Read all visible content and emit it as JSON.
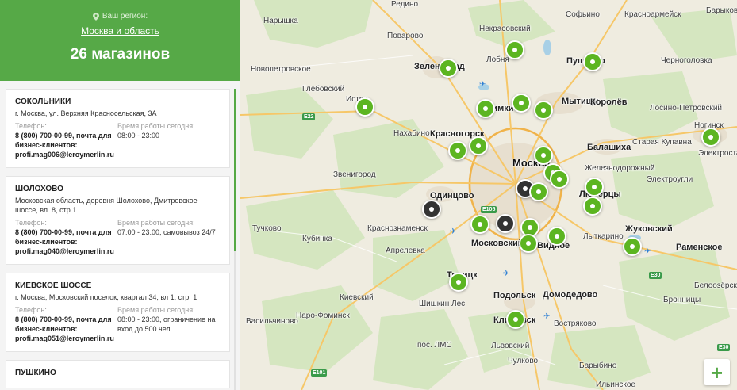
{
  "panel": {
    "region_label": "Ваш регион:",
    "region_name": "Москва и область",
    "store_count": "26 магазинов"
  },
  "stores": [
    {
      "name": "СОКОЛЬНИКИ",
      "address": "г. Москва, ул. Верхняя Красносельская, 3А",
      "phone_label": "Телефон:",
      "phone": "8 (800) 700-00-99, почта для бизнес-клиентов: profi.mag006@leroymerlin.ru",
      "hours_label": "Время работы сегодня:",
      "hours": "08:00 - 23:00"
    },
    {
      "name": "ШОЛОХОВО",
      "address": "Московская область, деревня Шолохово, Дмитровское шоссе, вл. 8, стр.1",
      "phone_label": "Телефон:",
      "phone": "8 (800) 700-00-99, почта для бизнес-клиентов: profi.mag040@leroymerlin.ru",
      "hours_label": "Время работы сегодня:",
      "hours": "07:00 - 23:00, самовывоз 24/7"
    },
    {
      "name": "КИЕВСКОЕ ШОССЕ",
      "address": "г. Москва, Московский поселок, квартал 34, вл 1, стр. 1",
      "phone_label": "Телефон:",
      "phone": "8 (800) 700-00-99, почта для бизнес-клиентов: profi.mag051@leroymerlin.ru",
      "hours_label": "Время работы сегодня:",
      "hours": "08:00 - 23:00, ограничение на вход до 500 чел."
    },
    {
      "name": "ПУШКИНО",
      "address": "",
      "phone_label": "",
      "phone": "",
      "hours_label": "",
      "hours": ""
    }
  ],
  "map": {
    "labels": [
      {
        "text": "Редино",
        "cls": ""
      },
      {
        "text": "Софьино",
        "cls": ""
      },
      {
        "text": "Красноармейск",
        "cls": ""
      },
      {
        "text": "Барыково",
        "cls": ""
      },
      {
        "text": "Нарышка",
        "cls": ""
      },
      {
        "text": "Некрасовский",
        "cls": ""
      },
      {
        "text": "Пушкино",
        "cls": "big"
      },
      {
        "text": "Черноголовка",
        "cls": ""
      },
      {
        "text": "Поварово",
        "cls": ""
      },
      {
        "text": "Зеленоград",
        "cls": "big"
      },
      {
        "text": "Лобня",
        "cls": ""
      },
      {
        "text": "Новопетровское",
        "cls": ""
      },
      {
        "text": "Глебовский",
        "cls": ""
      },
      {
        "text": "Истра",
        "cls": ""
      },
      {
        "text": "Мытищи",
        "cls": "big"
      },
      {
        "text": "Королёв",
        "cls": "big"
      },
      {
        "text": "Лосино-Петровский",
        "cls": ""
      },
      {
        "text": "Ногинск",
        "cls": ""
      },
      {
        "text": "Химки",
        "cls": "big"
      },
      {
        "text": "Нахабино",
        "cls": ""
      },
      {
        "text": "Красногорск",
        "cls": "big"
      },
      {
        "text": "Балашиха",
        "cls": "big"
      },
      {
        "text": "Старая Купавна",
        "cls": ""
      },
      {
        "text": "Электросталь",
        "cls": ""
      },
      {
        "text": "Звенигород",
        "cls": ""
      },
      {
        "text": "Москва",
        "cls": "capital"
      },
      {
        "text": "Железнодорожный",
        "cls": ""
      },
      {
        "text": "Электроугли",
        "cls": ""
      },
      {
        "text": "Одинцово",
        "cls": "big"
      },
      {
        "text": "Люберцы",
        "cls": "big"
      },
      {
        "text": "Тучково",
        "cls": ""
      },
      {
        "text": "Кубинка",
        "cls": ""
      },
      {
        "text": "Краснознаменск",
        "cls": ""
      },
      {
        "text": "Московский",
        "cls": "big"
      },
      {
        "text": "Жуковский",
        "cls": "big"
      },
      {
        "text": "Апрелевка",
        "cls": ""
      },
      {
        "text": "Видное",
        "cls": "big"
      },
      {
        "text": "Лыткарино",
        "cls": ""
      },
      {
        "text": "Раменское",
        "cls": "big"
      },
      {
        "text": "Троицк",
        "cls": "big"
      },
      {
        "text": "Белоозёрский",
        "cls": ""
      },
      {
        "text": "Киевский",
        "cls": ""
      },
      {
        "text": "Подольск",
        "cls": "big"
      },
      {
        "text": "Домодедово",
        "cls": "big"
      },
      {
        "text": "Бронницы",
        "cls": ""
      },
      {
        "text": "Шишкин Лес",
        "cls": ""
      },
      {
        "text": "Наро-Фоминск",
        "cls": ""
      },
      {
        "text": "Климовск",
        "cls": "big"
      },
      {
        "text": "Востряково",
        "cls": ""
      },
      {
        "text": "Васильчиново",
        "cls": ""
      },
      {
        "text": "пос. ЛМС",
        "cls": ""
      },
      {
        "text": "Львовский",
        "cls": ""
      },
      {
        "text": "Чулково",
        "cls": ""
      },
      {
        "text": "Барыбино",
        "cls": ""
      },
      {
        "text": "Ильинское",
        "cls": ""
      }
    ],
    "roads": [
      "E22",
      "E105",
      "E30",
      "E30",
      "E101"
    ],
    "stores_pins": [
      {
        "kind": "green"
      },
      {
        "kind": "green"
      },
      {
        "kind": "green"
      },
      {
        "kind": "green"
      },
      {
        "kind": "green"
      },
      {
        "kind": "green"
      },
      {
        "kind": "green"
      },
      {
        "kind": "green"
      },
      {
        "kind": "green"
      },
      {
        "kind": "green"
      },
      {
        "kind": "green"
      },
      {
        "kind": "green"
      },
      {
        "kind": "green"
      },
      {
        "kind": "green"
      },
      {
        "kind": "dark"
      },
      {
        "kind": "green"
      },
      {
        "kind": "green"
      },
      {
        "kind": "dark"
      },
      {
        "kind": "dark"
      },
      {
        "kind": "green"
      },
      {
        "kind": "green"
      },
      {
        "kind": "green"
      },
      {
        "kind": "green"
      },
      {
        "kind": "green"
      },
      {
        "kind": "green"
      },
      {
        "kind": "green"
      }
    ],
    "zoom_in_label": "+",
    "accent_color": "#56a947",
    "pin_color": "#5cb521",
    "selected_pin_color": "#333333"
  }
}
